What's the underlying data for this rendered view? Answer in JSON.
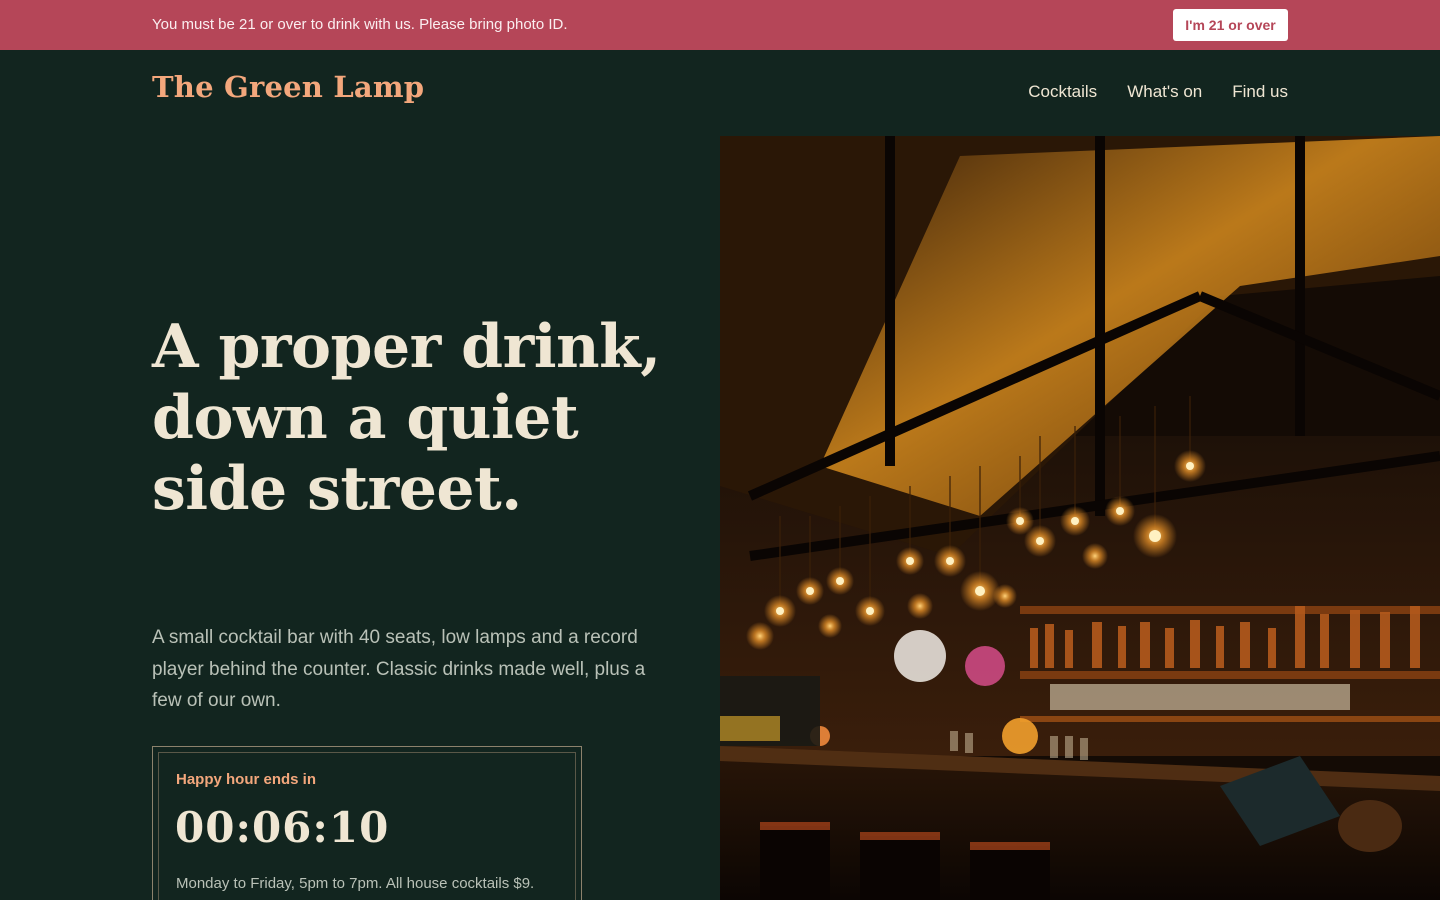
{
  "age_banner": {
    "message": "You must be 21 or over to drink with us. Please bring photo ID.",
    "button_label": "I'm 21 or over"
  },
  "header": {
    "brand": "The Green Lamp",
    "nav": [
      "Cocktails",
      "What's on",
      "Find us"
    ]
  },
  "hero": {
    "headline": "A proper drink, down a quiet side street.",
    "intro": "A small cocktail bar with 40 seats, low lamps and a record player behind the counter. Classic drinks made well, plus a few of our own."
  },
  "happy_hour": {
    "label": "Happy hour ends in",
    "countdown": "00:06:10",
    "note": "Monday to Friday, 5pm to 7pm. All house cocktails $9."
  },
  "colors": {
    "background": "#12251f",
    "banner": "#b54658",
    "accent": "#f3a77c",
    "cream": "#efe6d3"
  }
}
